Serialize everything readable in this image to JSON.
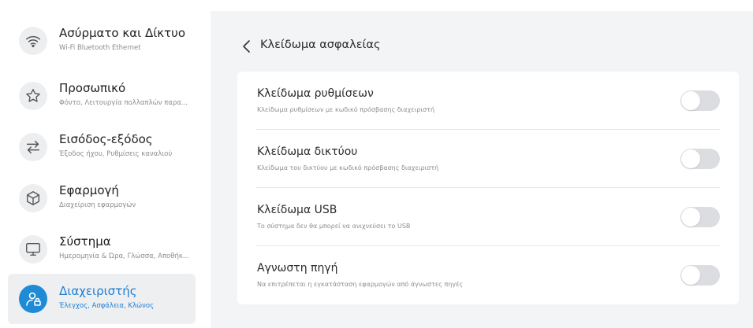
{
  "sidebar": {
    "items": [
      {
        "icon": "wifi-icon",
        "title": "Ασύρματο και Δίκτυο",
        "subtitle": "Wi-Fi Bluetooth Ethernet",
        "active": false
      },
      {
        "icon": "star-icon",
        "title": "Προσωπικό",
        "subtitle": "Φόντο, Λειτουργία πολλαπλών παρα...",
        "active": false
      },
      {
        "icon": "input-output-icon",
        "title": "Εισόδος-εξόδος",
        "subtitle": "Έξοδος ήχου, Ρυθμίσεις καναλιού",
        "active": false
      },
      {
        "icon": "cube-icon",
        "title": "Εφαρμογή",
        "subtitle": "Διαχείριση εφαρμογών",
        "active": false
      },
      {
        "icon": "monitor-icon",
        "title": "Σύστημα",
        "subtitle": "Ημερομηνία & Ώρα, Γλώσσα, Αποθήκ...",
        "active": false
      },
      {
        "icon": "admin-user-lock-icon",
        "title": "Διαχειριστής",
        "subtitle": "Έλεγχος, Ασφάλεια, Κλώνος",
        "active": true
      }
    ]
  },
  "header": {
    "back_icon": "chevron-left-icon",
    "title": "Κλείδωμα ασφαλείας"
  },
  "settings": [
    {
      "title": "Κλείδωμα ρυθμίσεων",
      "description": "Κλείδωμα ρυθμίσεων με κωδικό πρόσβασης διαχειριστή",
      "enabled": false
    },
    {
      "title": "Κλείδωμα δικτύου",
      "description": "Κλείδωμα του δικτύου με κωδικό πρόσβασης διαχειριστή",
      "enabled": false
    },
    {
      "title": "Κλείδωμα USB",
      "description": "Το σύστημα δεν θα μπορεί να ανιχνεύσει το USB",
      "enabled": false
    },
    {
      "title": "Αγνωστη πηγή",
      "description": "Να επιτρέπεται η εγκατάσταση εφαρμογών από άγνωστες πηγές",
      "enabled": false
    }
  ],
  "colors": {
    "accent": "#1f8ad6",
    "toggle_off": "#dcdde0",
    "panel_bg": "#f3f4f6"
  }
}
